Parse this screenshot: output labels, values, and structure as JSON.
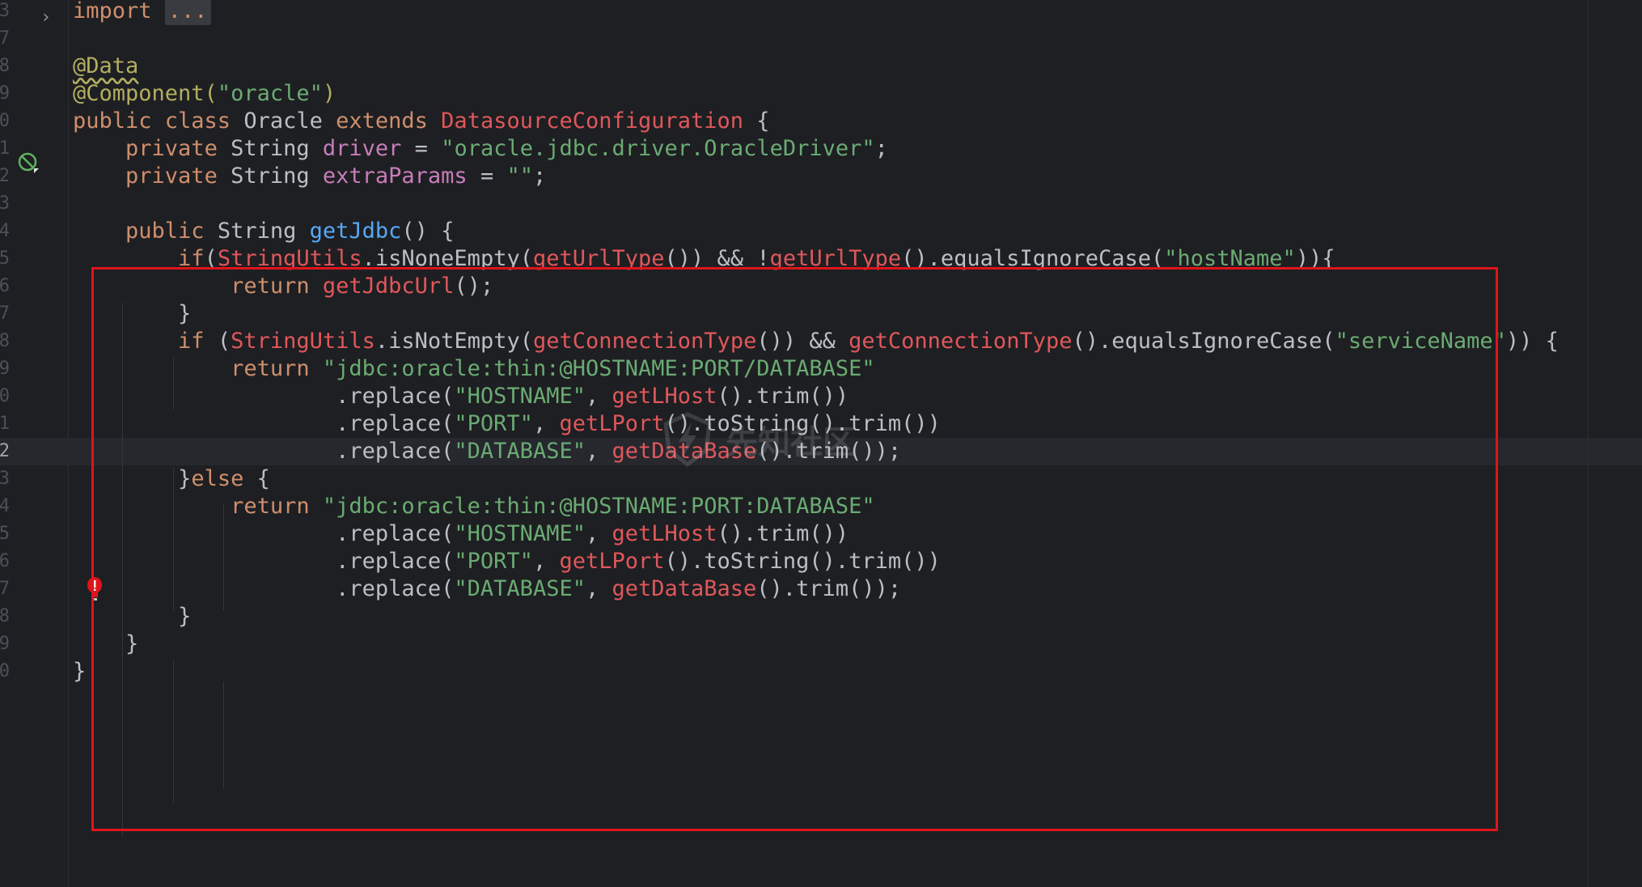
{
  "editor": {
    "language": "java",
    "current_line_number": "2",
    "colors": {
      "background": "#1e1f22",
      "current_line": "#26282e",
      "keyword": "#cf8e6d",
      "string": "#6aab73",
      "annotation": "#b3ae60",
      "field": "#c77dbb",
      "method_declaration": "#56a8f5",
      "method_call": "#e0575b",
      "highlight_box": "#e0141b"
    },
    "line_numbers": [
      "3",
      "7",
      "8",
      "9",
      "0",
      "1",
      "2",
      "3",
      "4",
      "5",
      "6",
      "7",
      "8",
      "9",
      "0",
      "1",
      "2",
      "3",
      "4",
      "5",
      "6",
      "7",
      "8",
      "9",
      "0"
    ],
    "lines": [
      {
        "t": [
          [
            "kw",
            "import "
          ],
          [
            "fold",
            "..."
          ]
        ]
      },
      {
        "t": []
      },
      {
        "t": [
          [
            "ann-sq",
            "@Data"
          ]
        ]
      },
      {
        "t": [
          [
            "ann",
            "@Component("
          ],
          [
            "str",
            "\"oracle\""
          ],
          [
            "ann",
            ")"
          ]
        ]
      },
      {
        "t": [
          [
            "kw",
            "public class "
          ],
          [
            "plain",
            "Oracle "
          ],
          [
            "kw",
            "extends "
          ],
          [
            "cls",
            "DatasourceConfiguration"
          ],
          [
            "plain",
            " {"
          ]
        ]
      },
      {
        "t": [
          [
            "plain",
            "    "
          ],
          [
            "kw",
            "private "
          ],
          [
            "plain",
            "String "
          ],
          [
            "fld",
            "driver"
          ],
          [
            "plain",
            " = "
          ],
          [
            "str",
            "\"oracle.jdbc.driver.OracleDriver\""
          ],
          [
            "plain",
            ";"
          ]
        ]
      },
      {
        "t": [
          [
            "plain",
            "    "
          ],
          [
            "kw",
            "private "
          ],
          [
            "plain",
            "String "
          ],
          [
            "fld",
            "extraParams"
          ],
          [
            "plain",
            " = "
          ],
          [
            "str",
            "\"\""
          ],
          [
            "plain",
            ";"
          ]
        ]
      },
      {
        "t": []
      },
      {
        "t": [
          [
            "plain",
            "    "
          ],
          [
            "kw",
            "public "
          ],
          [
            "plain",
            "String "
          ],
          [
            "fn",
            "getJdbc"
          ],
          [
            "plain",
            "() {"
          ]
        ]
      },
      {
        "t": [
          [
            "plain",
            "        "
          ],
          [
            "kw",
            "if"
          ],
          [
            "plain",
            "("
          ],
          [
            "cls",
            "StringUtils"
          ],
          [
            "plain",
            ".isNoneEmpty("
          ],
          [
            "call",
            "getUrlType"
          ],
          [
            "plain",
            "()) && !"
          ],
          [
            "call",
            "getUrlType"
          ],
          [
            "plain",
            "().equalsIgnoreCase("
          ],
          [
            "str",
            "\"hostName\""
          ],
          [
            "plain",
            ")){"
          ]
        ]
      },
      {
        "t": [
          [
            "plain",
            "            "
          ],
          [
            "kw",
            "return "
          ],
          [
            "call",
            "getJdbcUrl"
          ],
          [
            "plain",
            "();"
          ]
        ]
      },
      {
        "t": [
          [
            "plain",
            "        }"
          ]
        ]
      },
      {
        "t": [
          [
            "plain",
            "        "
          ],
          [
            "kw",
            "if "
          ],
          [
            "plain",
            "("
          ],
          [
            "cls",
            "StringUtils"
          ],
          [
            "plain",
            ".isNotEmpty("
          ],
          [
            "call",
            "getConnectionType"
          ],
          [
            "plain",
            "()) && "
          ],
          [
            "call",
            "getConnectionType"
          ],
          [
            "plain",
            "().equalsIgnoreCase("
          ],
          [
            "str",
            "\"serviceName\""
          ],
          [
            "plain",
            ")) {"
          ]
        ]
      },
      {
        "t": [
          [
            "plain",
            "            "
          ],
          [
            "kw",
            "return "
          ],
          [
            "str",
            "\"jdbc:oracle:thin:@HOSTNAME:PORT/DATABASE\""
          ]
        ]
      },
      {
        "t": [
          [
            "plain",
            "                    .replace("
          ],
          [
            "str",
            "\"HOSTNAME\""
          ],
          [
            "plain",
            ", "
          ],
          [
            "call",
            "getLHost"
          ],
          [
            "plain",
            "().trim())"
          ]
        ]
      },
      {
        "t": [
          [
            "plain",
            "                    .replace("
          ],
          [
            "str",
            "\"PORT\""
          ],
          [
            "plain",
            ", "
          ],
          [
            "call",
            "getLPort"
          ],
          [
            "plain",
            "().toString().trim())"
          ]
        ]
      },
      {
        "t": [
          [
            "plain",
            "                    .replace("
          ],
          [
            "str",
            "\"DATABASE\""
          ],
          [
            "plain",
            ", "
          ],
          [
            "call",
            "getDataBase"
          ],
          [
            "plain",
            "().trim());"
          ]
        ]
      },
      {
        "t": [
          [
            "plain",
            "        }"
          ],
          [
            "kw",
            "else"
          ],
          [
            "plain",
            " {"
          ]
        ]
      },
      {
        "t": [
          [
            "plain",
            "            "
          ],
          [
            "kw",
            "return "
          ],
          [
            "str",
            "\"jdbc:oracle:thin:@HOSTNAME:PORT:DATABASE\""
          ]
        ]
      },
      {
        "t": [
          [
            "plain",
            "                    .replace("
          ],
          [
            "str",
            "\"HOSTNAME\""
          ],
          [
            "plain",
            ", "
          ],
          [
            "call",
            "getLHost"
          ],
          [
            "plain",
            "().trim())"
          ]
        ]
      },
      {
        "t": [
          [
            "plain",
            "                    .replace("
          ],
          [
            "str",
            "\"PORT\""
          ],
          [
            "plain",
            ", "
          ],
          [
            "call",
            "getLPort"
          ],
          [
            "plain",
            "().toString().trim())"
          ]
        ]
      },
      {
        "t": [
          [
            "plain",
            "                    .replace("
          ],
          [
            "str",
            "\"DATABASE\""
          ],
          [
            "plain",
            ", "
          ],
          [
            "call",
            "getDataBase"
          ],
          [
            "plain",
            "().trim());"
          ]
        ]
      },
      {
        "t": [
          [
            "plain",
            "        }"
          ]
        ]
      },
      {
        "t": [
          [
            "plain",
            "    }"
          ]
        ]
      },
      {
        "t": [
          [
            "plain",
            "}"
          ]
        ]
      }
    ],
    "watermark_text": "先知社区",
    "icons": {
      "fold": "chevron-right-icon",
      "class_marker": "spring-bean-icon",
      "intention": "error-bulb-icon"
    }
  }
}
